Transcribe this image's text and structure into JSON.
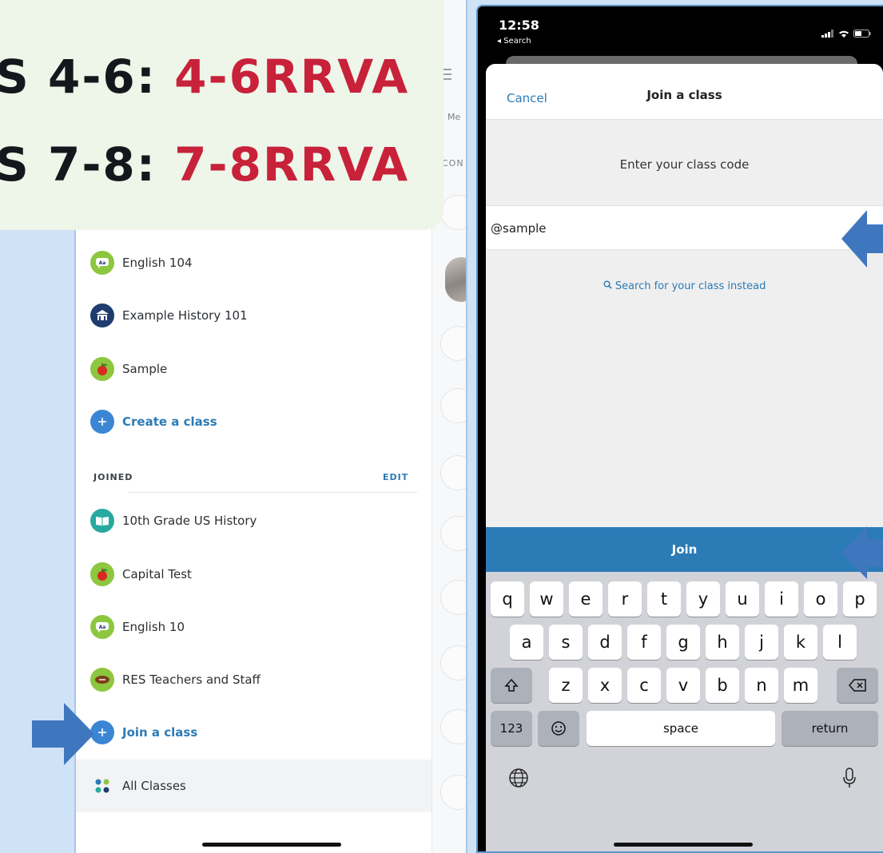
{
  "banner": {
    "lines": [
      {
        "prefix": "S 4-6: ",
        "code": "4-6RRVA"
      },
      {
        "prefix": "S 7-8: ",
        "code": "7-8RRVA"
      }
    ],
    "colors": {
      "prefix": "#14181c",
      "code": "#c8213a",
      "background": "#eef5e9"
    }
  },
  "left_phone": {
    "owned_classes": [
      {
        "label": "English 104",
        "icon": "speech-bubble-icon",
        "color": "#8dc63f"
      },
      {
        "label": "Example History 101",
        "icon": "school-building-icon",
        "color": "#1f3c6e"
      },
      {
        "label": "Sample",
        "icon": "apple-icon",
        "color": "#8dc63f"
      }
    ],
    "create_class": "Create a class",
    "joined_header": "JOINED",
    "edit_label": "EDIT",
    "joined_classes": [
      {
        "label": "10th Grade US History",
        "icon": "book-icon",
        "color": "#27a9a0"
      },
      {
        "label": "Capital Test",
        "icon": "apple-icon",
        "color": "#8dc63f"
      },
      {
        "label": "English 10",
        "icon": "speech-bubble-icon",
        "color": "#8dc63f"
      },
      {
        "label": "RES Teachers and Staff",
        "icon": "football-icon",
        "color": "#8dc63f"
      }
    ],
    "join_class": "Join a class",
    "all_classes": "All Classes",
    "side": {
      "tab_fragment": "Me",
      "section_fragment": "CON"
    },
    "accent": "#2b7bb6"
  },
  "right_phone": {
    "status": {
      "time": "12:58",
      "back": "◂ Search"
    },
    "nav": {
      "cancel": "Cancel",
      "title": "Join a class"
    },
    "prompt": "Enter your class code",
    "input_value": "@sample",
    "search_instead": "Search for your class instead",
    "join_button": "Join",
    "keyboard": {
      "row1": [
        "q",
        "w",
        "e",
        "r",
        "t",
        "y",
        "u",
        "i",
        "o",
        "p"
      ],
      "row2": [
        "a",
        "s",
        "d",
        "f",
        "g",
        "h",
        "j",
        "k",
        "l"
      ],
      "row3": [
        "z",
        "x",
        "c",
        "v",
        "b",
        "n",
        "m"
      ],
      "numbers": "123",
      "space": "space",
      "return": "return"
    }
  }
}
